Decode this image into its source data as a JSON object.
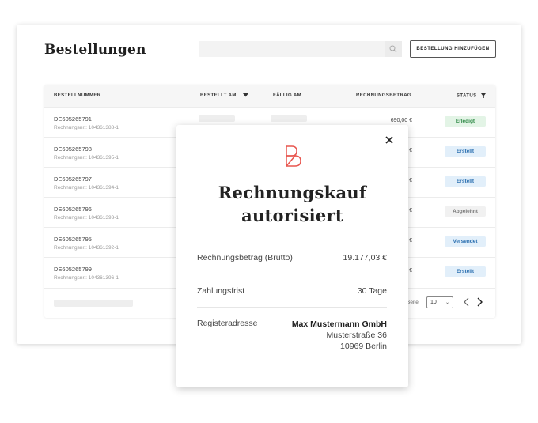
{
  "header": {
    "title": "Bestellungen",
    "search_placeholder": "",
    "add_button_label": "BESTELLUNG HINZUFÜGEN"
  },
  "table": {
    "columns": {
      "order_number": "BESTELLNUMMER",
      "ordered_at": "BESTELLT AM",
      "due_at": "FÄLLIG AM",
      "invoice_amount": "RECHNUNGSBETRAG",
      "status": "STATUS"
    },
    "rows": [
      {
        "order_no": "DE605265791",
        "invoice_no": "Rechnungsnr.: 104361388-1",
        "amount": "690,00 €",
        "status": "Erledigt"
      },
      {
        "order_no": "DE605265798",
        "invoice_no": "Rechnungsnr.: 104361395-1",
        "amount": "€",
        "status": "Erstellt"
      },
      {
        "order_no": "DE605265797",
        "invoice_no": "Rechnungsnr.: 104361394-1",
        "amount": "€",
        "status": "Erstellt"
      },
      {
        "order_no": "DE605265796",
        "invoice_no": "Rechnungsnr.: 104361393-1",
        "amount": "€",
        "status": "Abgelehnt"
      },
      {
        "order_no": "DE605265795",
        "invoice_no": "Rechnungsnr.: 104361392-1",
        "amount": "€",
        "status": "Versendet"
      },
      {
        "order_no": "DE605265799",
        "invoice_no": "Rechnungsnr.: 104361396-1",
        "amount": "€",
        "status": "Erstellt"
      }
    ],
    "footer": {
      "page_label": "Seite",
      "page_size": "10"
    }
  },
  "status_colors": {
    "Erledigt": {
      "bg": "#e3f4e6",
      "fg": "#2f8a47"
    },
    "Erstellt": {
      "bg": "#e2effa",
      "fg": "#2a6fb0"
    },
    "Abgelehnt": {
      "bg": "#f1f1f1",
      "fg": "#777777"
    },
    "Versendet": {
      "bg": "#e2effa",
      "fg": "#2a6fb0"
    }
  },
  "modal": {
    "title_line1": "Rechnungskauf",
    "title_line2": "autorisiert",
    "invoice_amount_label": "Rechnungsbetrag (Brutto)",
    "invoice_amount_value": "19.177,03 €",
    "payment_term_label": "Zahlungsfrist",
    "payment_term_value": "30 Tage",
    "address_label": "Registeradresse",
    "address_company": "Max Mustermann GmbH",
    "address_street": "Musterstraße 36",
    "address_city": "10969 Berlin",
    "accent_color": "#e8564f"
  }
}
